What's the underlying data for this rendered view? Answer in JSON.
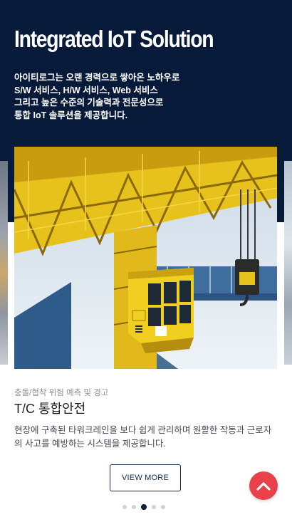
{
  "hero": {
    "title": "Integrated IoT Solution",
    "description": [
      "아이티로그는 오랜 경력으로 쌓아온 노하우로",
      "S/W 서비스, H/W 서비스, Web 서비스",
      "그리고 높은 수준의 기술력과 전문성으로",
      "통합 IoT 솔루션을 제공합니다."
    ]
  },
  "card": {
    "image_alt": "Yellow tower crane operator cabin",
    "subtitle": "충돌/협착 위험 예측 및 경고",
    "title": "T/C 통합안전",
    "description": "현장에 구축된 타워크레인을 보다 쉽게 관리하며 원활한 작동과 근로자의 사고를 예방하는 시스템을 제공합니다.",
    "button_label": "VIEW MORE"
  },
  "carousel": {
    "total": 5,
    "active_index": 3
  },
  "colors": {
    "hero_bg": "#071a3a",
    "accent": "#e8414a",
    "button_border": "#142a52"
  },
  "icons": {
    "scroll_top": "chevron-up-icon"
  }
}
